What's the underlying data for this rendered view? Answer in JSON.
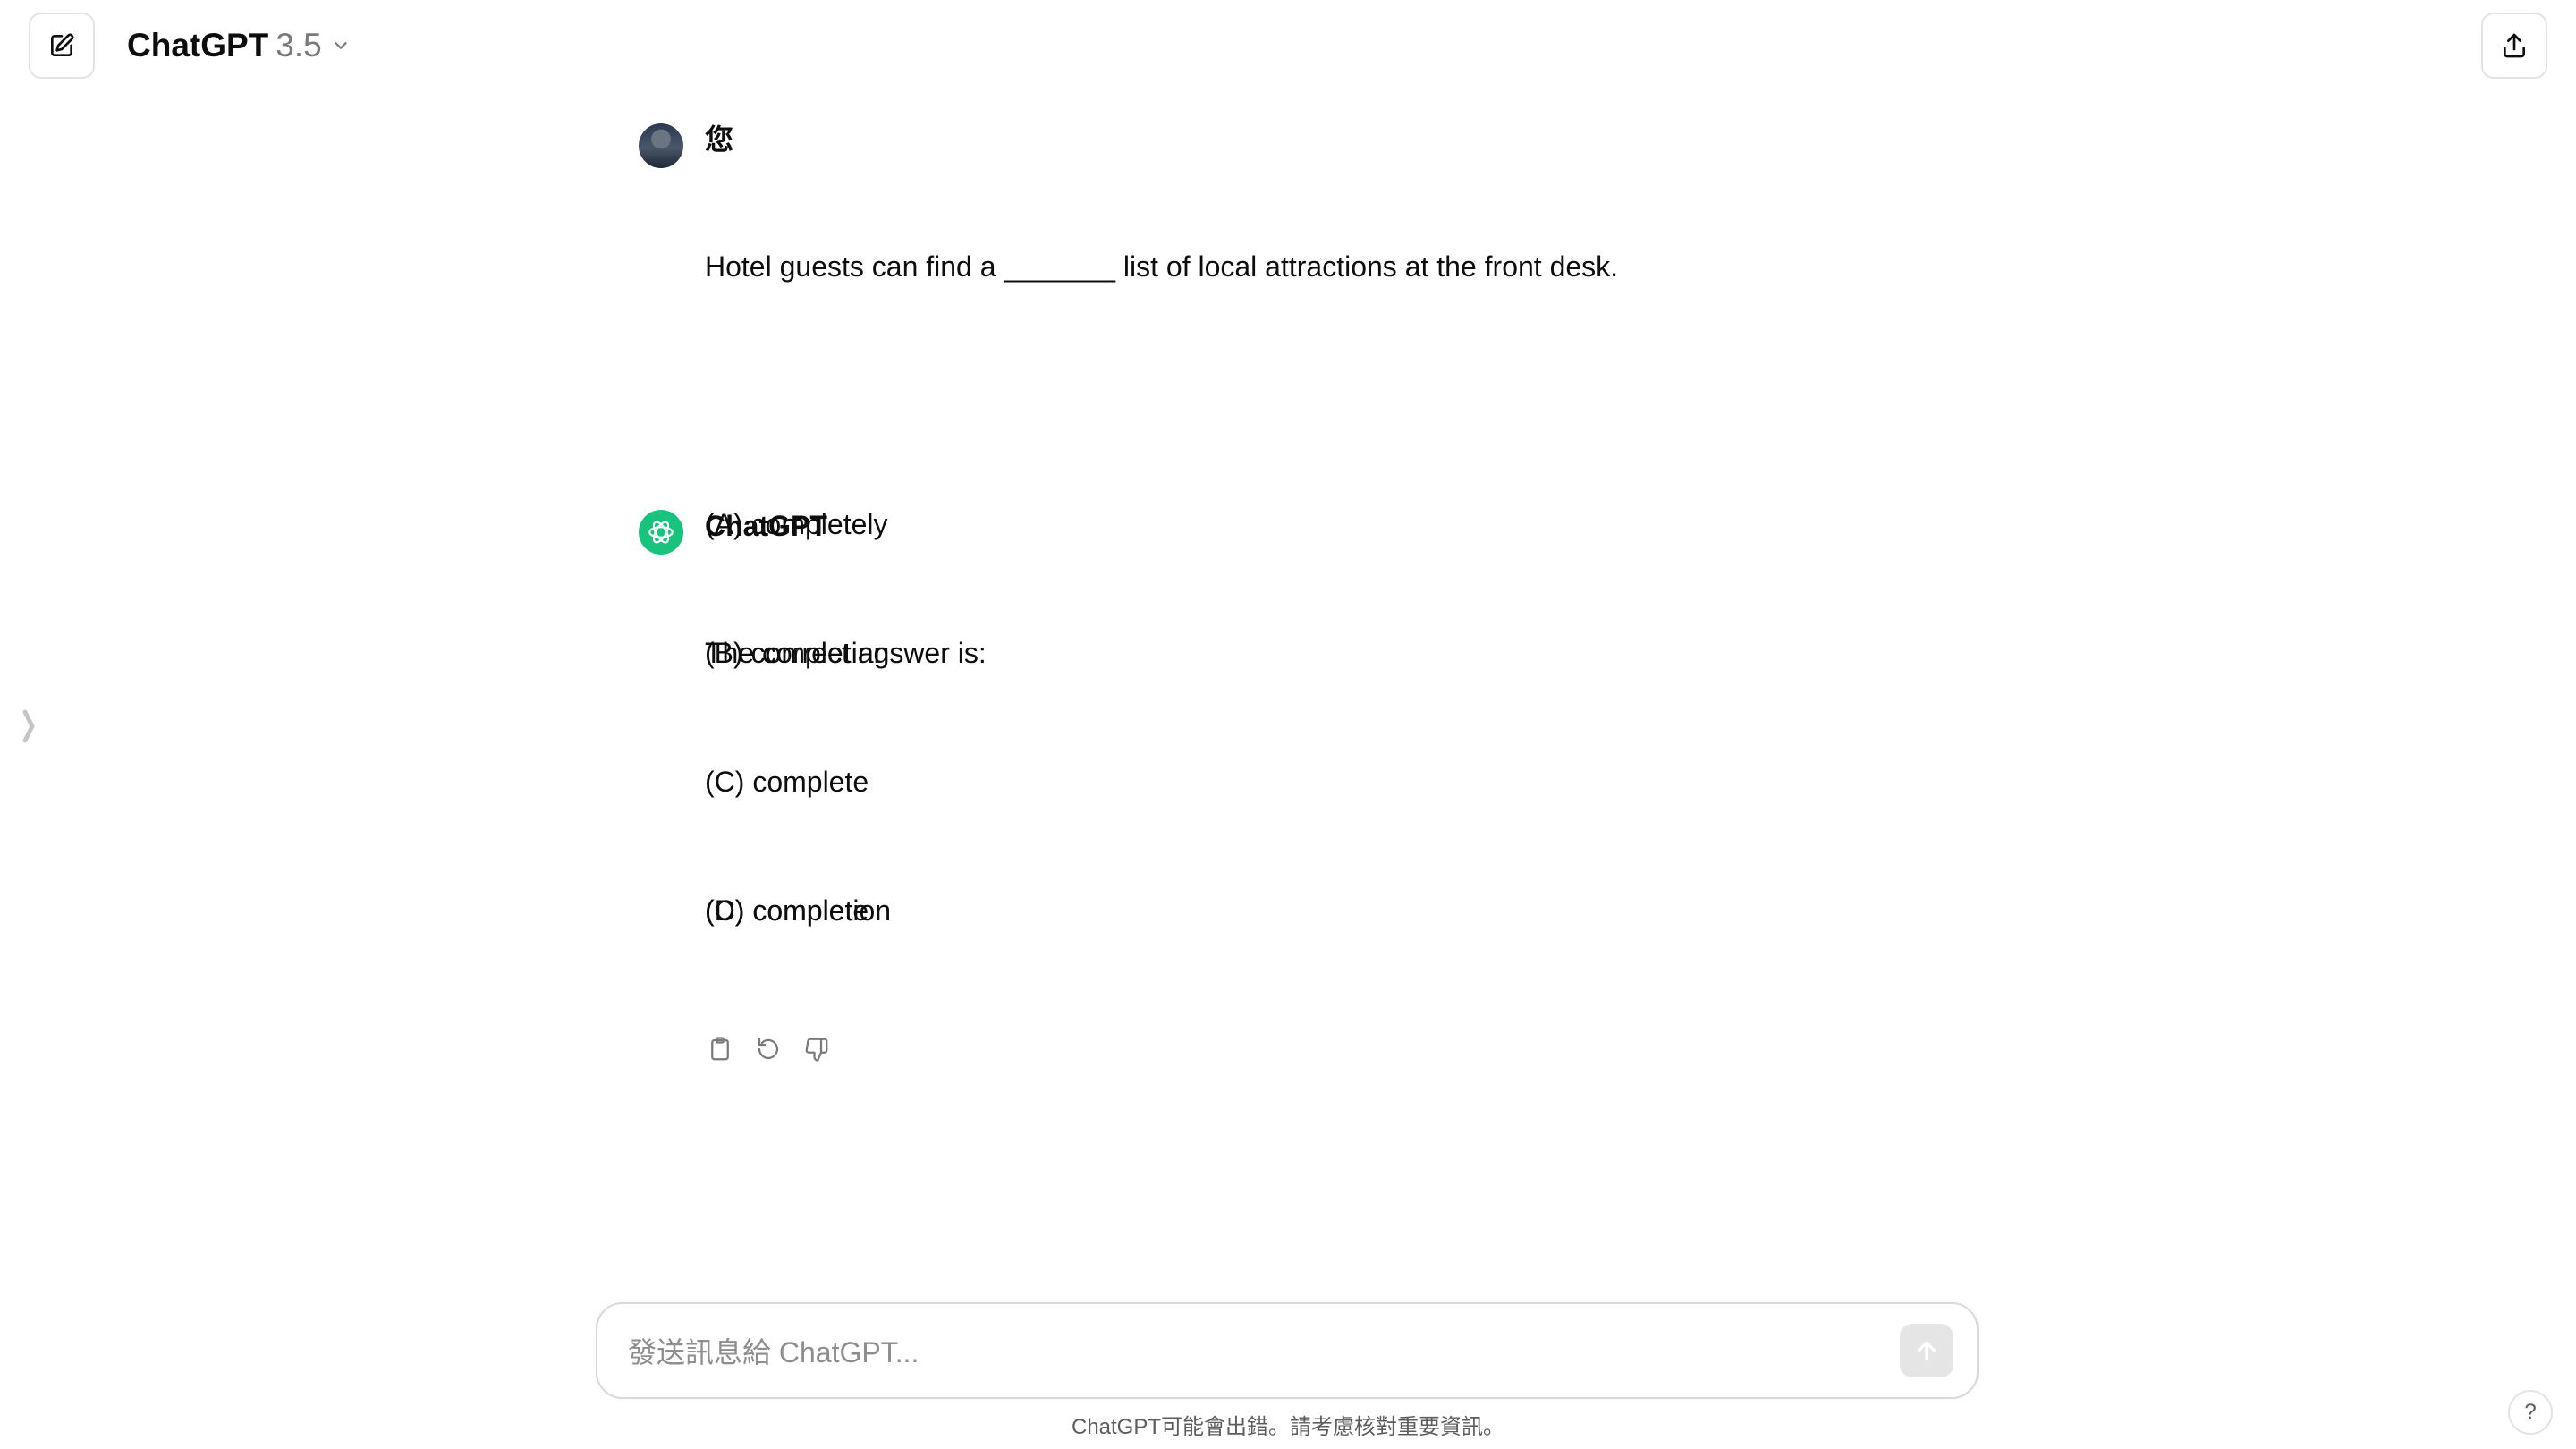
{
  "header": {
    "model_name": "ChatGPT",
    "model_version": "3.5",
    "icons": {
      "new_chat": "edit-square-icon",
      "model_dropdown": "chevron-down-icon",
      "share": "share-upload-icon",
      "sidebar_toggle": "chevron-right-icon"
    }
  },
  "conversation": {
    "user": {
      "author": "您",
      "lines": [
        "Hotel guests can find a _______ list of local attractions at the front desk.",
        "",
        "(A) completely",
        "(B) completing",
        "(C) complete",
        "(D) completion"
      ]
    },
    "assistant": {
      "author": "ChatGPT",
      "lines": [
        "The correct answer is:",
        "",
        "(C) complete"
      ],
      "actions": [
        "clipboard-icon",
        "regenerate-icon",
        "thumbs-down-icon"
      ]
    }
  },
  "composer": {
    "placeholder": "發送訊息給 ChatGPT...",
    "value": "",
    "send_icon": "arrow-up-icon"
  },
  "footer": {
    "disclaimer": "ChatGPT可能會出錯。請考慮核對重要資訊。",
    "help_label": "?"
  },
  "colors": {
    "accent_green": "#19c37d",
    "border": "#e3e3e3",
    "muted_text": "#7a7a7a"
  }
}
